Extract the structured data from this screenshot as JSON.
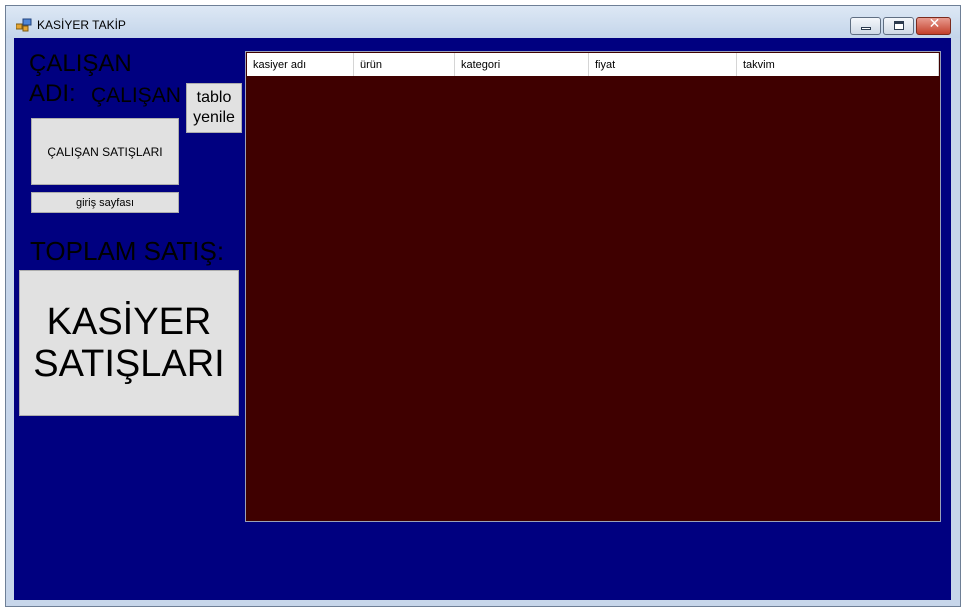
{
  "window": {
    "title": "KASİYER TAKİP",
    "icon": "app-form-icon",
    "controls": [
      "minimize-icon",
      "maximize-icon",
      "close-icon"
    ]
  },
  "labels": {
    "calisan": "ÇALIŞAN",
    "adi": "ADI:",
    "employee_name": "ÇALIŞAN",
    "toplam_satis": "TOPLAM SATIŞ:"
  },
  "buttons": {
    "tablo_yenile": "tablo yenile",
    "calisan_satislari": "ÇALIŞAN SATIŞLARI",
    "giris_sayfasi": "giriş sayfası",
    "kasiyer_satislari": "KASİYER SATIŞLARI"
  },
  "grid": {
    "columns": [
      "kasiyer adı",
      "ürün",
      "kategori",
      "fiyat",
      "takvim"
    ],
    "rows": []
  },
  "colors": {
    "client_background": "#000080",
    "grid_background": "#3f0000",
    "button_face": "#e1e1e1"
  }
}
